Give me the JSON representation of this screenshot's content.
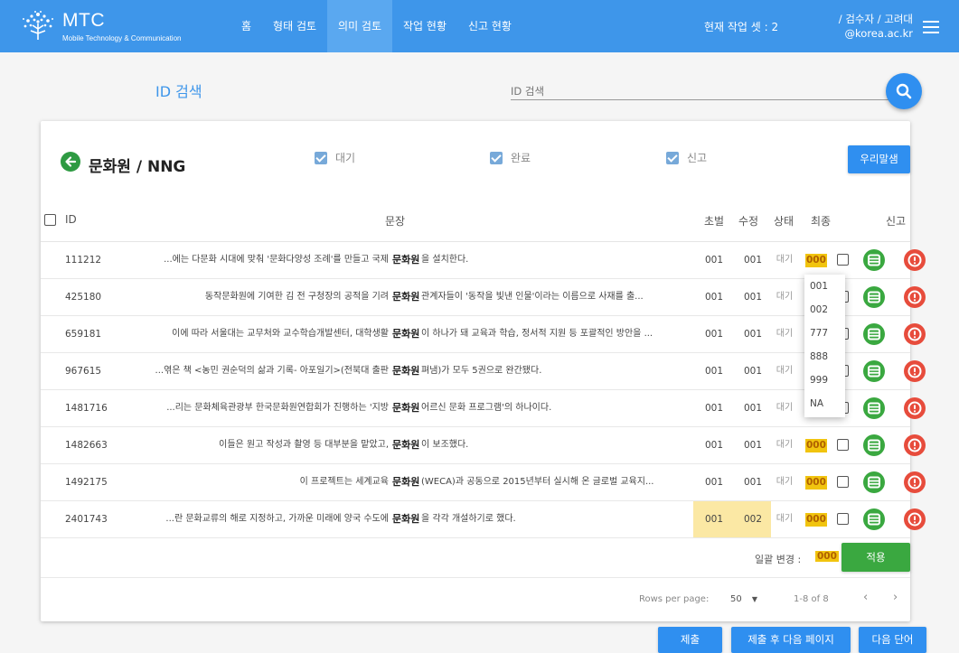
{
  "header": {
    "logo_title": "MTC",
    "logo_subtitle": "Mobile Technology & Communication",
    "nav": [
      "홈",
      "형태 검토",
      "의미 검토",
      "작업 현황",
      "신고 현황"
    ],
    "current_set": "현재 작업 셋 : 2",
    "user_line1": "/ 검수자 / 고려대",
    "user_line2": "@korea.ac.kr",
    "accent": "#3e96ea"
  },
  "search": {
    "title": "ID 검색",
    "placeholder": "ID 검색"
  },
  "card": {
    "title": "문화원 / NNG",
    "filters": [
      "대기",
      "완료",
      "신고"
    ],
    "dict_button": "우리말샘"
  },
  "table": {
    "headers": {
      "id": "ID",
      "sentence": "문장",
      "first": "초벌",
      "revised": "수정",
      "status": "상태",
      "final": "최종",
      "report": "신고"
    },
    "rows": [
      {
        "id": "111212",
        "left": "...에는 다문화 시대에 맞춰 '문화다양성 조례'를 만들고 국제",
        "key": "문화원",
        "right": "을 설치한다.",
        "first": "001",
        "revised": "001",
        "status": "대기",
        "final": "000"
      },
      {
        "id": "425180",
        "left": "동작문화원에 기여한 김 전 구청장의 공적을 기려",
        "key": "문화원",
        "right": "관계자들이 '동작을 빛낸 인물'이라는 이름으로 사재를 출...",
        "first": "001",
        "revised": "001",
        "status": "대기",
        "final": ""
      },
      {
        "id": "659181",
        "left": "이에 따라 서울대는 교무처와 교수학습개발센터, 대학생활",
        "key": "문화원",
        "right": "이 하나가 돼 교육과 학습, 정서적 지원 등 포괄적인 방안을 ...",
        "first": "001",
        "revised": "001",
        "status": "대기",
        "final": ""
      },
      {
        "id": "967615",
        "left": "...엮은 책 <농민 권순덕의 삶과 기록- 아포일기>(전북대 출판",
        "key": "문화원",
        "right": "펴냄)가 모두 5권으로 완간됐다.",
        "first": "001",
        "revised": "001",
        "status": "대기",
        "final": ""
      },
      {
        "id": "1481716",
        "left": "...리는 문화체육관광부 한국문화원연합회가 진행하는 '지방",
        "key": "문화원",
        "right": "어르신 문화 프로그램'의 하나이다.",
        "first": "001",
        "revised": "001",
        "status": "대기",
        "final": ""
      },
      {
        "id": "1482663",
        "left": "이들은 원고 작성과 촬영 등 대부분을 맡았고,",
        "key": "문화원",
        "right": "이 보조했다.",
        "first": "001",
        "revised": "001",
        "status": "대기",
        "final": "000"
      },
      {
        "id": "1492175",
        "left": "이 프로젝트는 세계교육",
        "key": "문화원",
        "right": "(WECA)과 공동으로 2015년부터 실시해 온 글로벌 교육지...",
        "first": "001",
        "revised": "001",
        "status": "대기",
        "final": "000"
      },
      {
        "id": "2401743",
        "left": "...란 문화교류의 해로 지정하고, 가까운 미래에 양국 수도에",
        "key": "문화원",
        "right": "을 각각 개설하기로 했다.",
        "first": "001",
        "revised": "002",
        "status": "대기",
        "final": "000"
      }
    ],
    "dropdown_options": [
      "001",
      "002",
      "777",
      "888",
      "999",
      "NA"
    ]
  },
  "bulk": {
    "label": "일괄 변경 :",
    "value": "000",
    "apply": "적용"
  },
  "pager": {
    "rows_per_page_label": "Rows per page:",
    "rows_per_page": "50",
    "range": "1-8 of 8"
  },
  "actions": {
    "submit": "제출",
    "submit_next_page": "제출 후 다음 페이지",
    "next_word": "다음 단어"
  }
}
